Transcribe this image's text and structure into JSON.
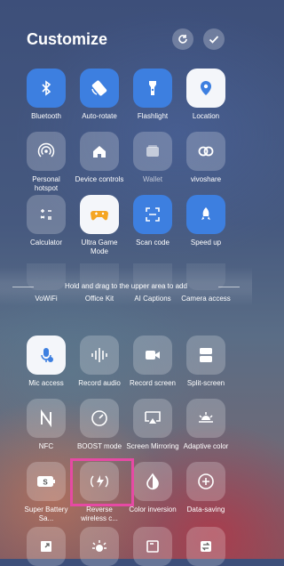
{
  "header": {
    "title": "Customize",
    "reset_icon": "refresh-icon",
    "confirm_icon": "check-icon"
  },
  "active_tiles": [
    {
      "label": "Bluetooth",
      "icon": "bluetooth-icon"
    },
    {
      "label": "Auto-rotate",
      "icon": "rotate-icon"
    },
    {
      "label": "Flashlight",
      "icon": "flashlight-icon"
    },
    {
      "label": "Location",
      "icon": "location-icon"
    },
    {
      "label": "Personal hotspot",
      "icon": "hotspot-icon"
    },
    {
      "label": "Device controls",
      "icon": "home-icon"
    },
    {
      "label": "Wallet",
      "icon": "wallet-icon"
    },
    {
      "label": "vivoshare",
      "icon": "vivoshare-icon"
    },
    {
      "label": "Calculator",
      "icon": "calculator-icon"
    },
    {
      "label": "Ultra Game Mode",
      "icon": "gamepad-icon"
    },
    {
      "label": "Scan code",
      "icon": "scan-icon"
    },
    {
      "label": "Speed up",
      "icon": "rocket-icon"
    }
  ],
  "hint_text": "Hold and drag to the upper area to add",
  "available_tiles": [
    {
      "label": "VoWiFi",
      "icon": "vowifi-icon"
    },
    {
      "label": "Office Kit",
      "icon": "office-kit-icon"
    },
    {
      "label": "AI Captions",
      "icon": "ai-captions-icon"
    },
    {
      "label": "Camera access",
      "icon": "camera-access-icon"
    },
    {
      "label": "Mic access",
      "icon": "mic-icon"
    },
    {
      "label": "Record audio",
      "icon": "audio-wave-icon"
    },
    {
      "label": "Record screen",
      "icon": "video-record-icon"
    },
    {
      "label": "Split-screen",
      "icon": "split-screen-icon"
    },
    {
      "label": "NFC",
      "icon": "nfc-icon"
    },
    {
      "label": "BOOST mode",
      "icon": "speedometer-icon"
    },
    {
      "label": "Screen Mirroring",
      "icon": "screen-mirror-icon"
    },
    {
      "label": "Adaptive color",
      "icon": "brightness-icon"
    },
    {
      "label": "Super Battery Sa...",
      "icon": "battery-icon"
    },
    {
      "label": "Reverse wireless c...",
      "icon": "wireless-charge-icon"
    },
    {
      "label": "Color inversion",
      "icon": "invert-icon"
    },
    {
      "label": "Data-saving",
      "icon": "data-saving-icon"
    }
  ],
  "partial_row_icons": [
    "resize-icon",
    "sun-icon",
    "window-icon",
    "transfer-icon"
  ],
  "colors": {
    "active_blue": "#3d7fe0",
    "highlight": "#e64aa4",
    "game_orange": "#f5a623"
  }
}
